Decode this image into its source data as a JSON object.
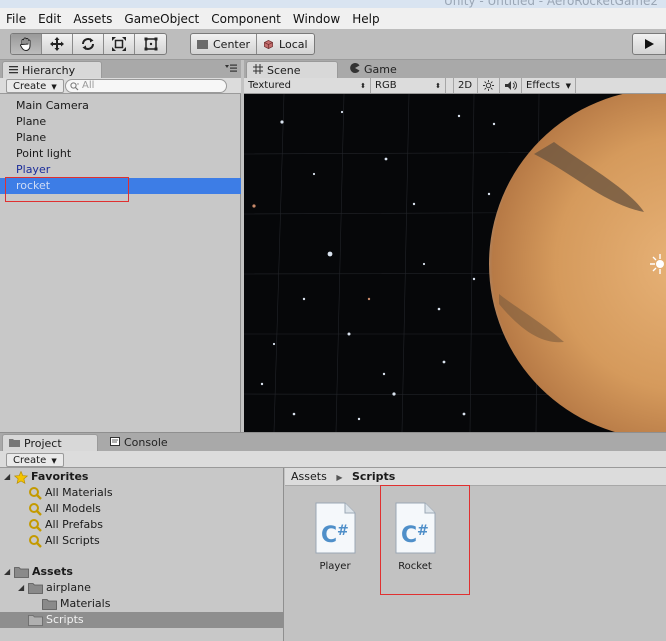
{
  "window": {
    "title": "Unity - Untitled - AeroRocketGame2"
  },
  "menu": [
    "File",
    "Edit",
    "Assets",
    "GameObject",
    "Component",
    "Window",
    "Help"
  ],
  "toolbar": {
    "tools": [
      "hand-tool",
      "move-tool",
      "rotate-tool",
      "scale-tool",
      "rect-tool"
    ],
    "pivot_center": "Center",
    "pivot_local": "Local"
  },
  "hierarchy": {
    "tab_label": "Hierarchy",
    "create_label": "Create",
    "search_placeholder": "All",
    "items": [
      {
        "label": "Main Camera",
        "kind": "normal"
      },
      {
        "label": "Plane",
        "kind": "normal"
      },
      {
        "label": "Plane",
        "kind": "normal"
      },
      {
        "label": "Point light",
        "kind": "normal"
      },
      {
        "label": "Player",
        "kind": "prefab"
      },
      {
        "label": "rocket",
        "kind": "selected"
      }
    ]
  },
  "scene": {
    "scene_tab": "Scene",
    "game_tab": "Game",
    "shading_mode": "Textured",
    "render_mode": "RGB",
    "mode_2d": "2D",
    "effects_label": "Effects"
  },
  "project": {
    "project_tab": "Project",
    "console_tab": "Console",
    "create_label": "Create",
    "favorites": {
      "label": "Favorites",
      "items": [
        "All Materials",
        "All Models",
        "All Prefabs",
        "All Scripts"
      ]
    },
    "assets": {
      "label": "Assets",
      "folders": [
        {
          "label": "airplane",
          "level": 1
        },
        {
          "label": "Materials",
          "level": 2
        },
        {
          "label": "Scripts",
          "level": 1,
          "selected": true
        }
      ]
    },
    "breadcrumb": {
      "root": "Assets",
      "current": "Scripts"
    },
    "files": [
      {
        "label": "Player",
        "type": "csharp-script"
      },
      {
        "label": "Rocket",
        "type": "csharp-script"
      }
    ]
  },
  "colors": {
    "selection_blue": "#3d7de6",
    "prefab_text": "#1b2d9a",
    "highlight_red": "#e03030"
  }
}
